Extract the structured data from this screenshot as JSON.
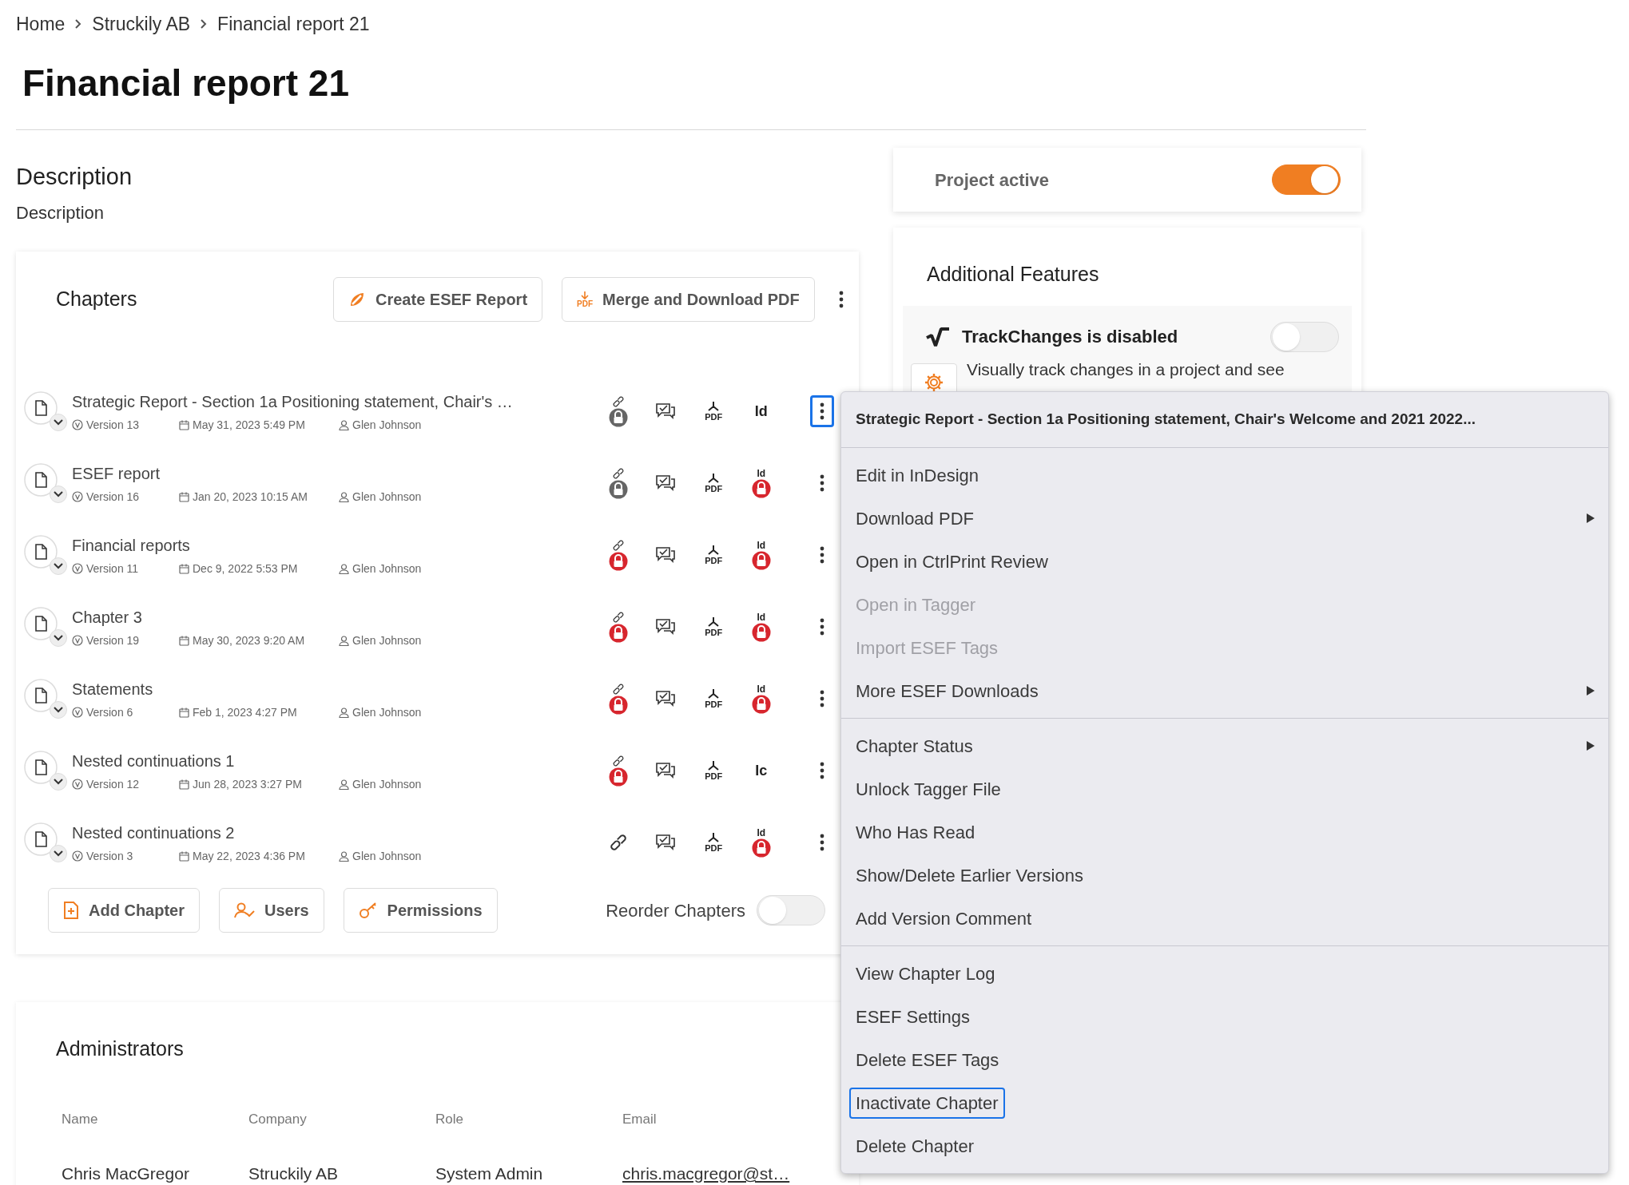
{
  "breadcrumb": [
    {
      "label": "Home"
    },
    {
      "label": "Struckily AB"
    },
    {
      "label": "Financial report 21"
    }
  ],
  "title": "Financial report 21",
  "description": {
    "heading": "Description",
    "text": "Description"
  },
  "chapters": {
    "heading": "Chapters",
    "actions": [
      {
        "label": "Create ESEF Report",
        "kind": "esef"
      },
      {
        "label": "Merge and Download PDF",
        "kind": "pdf",
        "icon_label": "PDF"
      }
    ],
    "rows": [
      {
        "title": "Strategic Report - Section 1a Positioning statement, Chair's …",
        "version": "Version 13",
        "date": "May 31, 2023 5:49 PM",
        "author": "Glen Johnson",
        "link_locked": true,
        "link_lock_alert": false,
        "pdf_label": "PDF",
        "id_label": "Id",
        "id_locked": false,
        "menu_open": true
      },
      {
        "title": "ESEF report",
        "version": "Version 16",
        "date": "Jan 20, 2023 10:15 AM",
        "author": "Glen Johnson",
        "link_locked": true,
        "link_lock_alert": false,
        "pdf_label": "PDF",
        "id_label": "Id",
        "id_locked": true,
        "menu_open": false
      },
      {
        "title": "Financial reports",
        "version": "Version 11",
        "date": "Dec 9, 2022 5:53 PM",
        "author": "Glen Johnson",
        "link_locked": true,
        "link_lock_alert": true,
        "pdf_label": "PDF",
        "id_label": "Id",
        "id_locked": true,
        "menu_open": false
      },
      {
        "title": "Chapter 3",
        "version": "Version 19",
        "date": "May 30, 2023 9:20 AM",
        "author": "Glen Johnson",
        "link_locked": true,
        "link_lock_alert": true,
        "pdf_label": "PDF",
        "id_label": "Id",
        "id_locked": true,
        "menu_open": false
      },
      {
        "title": "Statements",
        "version": "Version 6",
        "date": "Feb 1, 2023 4:27 PM",
        "author": "Glen Johnson",
        "link_locked": true,
        "link_lock_alert": true,
        "pdf_label": "PDF",
        "id_label": "Id",
        "id_locked": true,
        "menu_open": false
      },
      {
        "title": "Nested continuations 1",
        "version": "Version 12",
        "date": "Jun 28, 2023 3:27 PM",
        "author": "Glen Johnson",
        "link_locked": true,
        "link_lock_alert": true,
        "pdf_label": "PDF",
        "id_label": "Ic",
        "id_locked": false,
        "menu_open": false
      },
      {
        "title": "Nested continuations 2",
        "version": "Version 3",
        "date": "May 22, 2023 4:36 PM",
        "author": "Glen Johnson",
        "link_locked": false,
        "pdf_label": "PDF",
        "id_label": "Id",
        "id_locked": true,
        "menu_open": false
      }
    ],
    "footer_buttons": [
      {
        "label": "Add Chapter",
        "kind": "add"
      },
      {
        "label": "Users",
        "kind": "users"
      },
      {
        "label": "Permissions",
        "kind": "key"
      }
    ],
    "reorder": {
      "label": "Reorder Chapters",
      "on": false
    }
  },
  "administrators": {
    "heading": "Administrators",
    "columns": [
      "Name",
      "Company",
      "Role",
      "Email"
    ],
    "rows": [
      [
        "Chris MacGregor",
        "Struckily AB",
        "System Admin",
        "chris.macgregor@st…"
      ]
    ]
  },
  "project_active": {
    "label": "Project active",
    "on": true
  },
  "additional_features": {
    "heading": "Additional Features",
    "features": [
      {
        "label": "TrackChanges is disabled",
        "on": false,
        "description": "Visually track changes in a project and see"
      }
    ]
  },
  "context_menu": {
    "header": "Strategic Report - Section 1a Positioning statement, Chair's Welcome and 2021 2022...",
    "groups": [
      [
        {
          "label": "Edit in InDesign",
          "disabled": false,
          "submenu": false,
          "focused": false
        },
        {
          "label": "Download PDF",
          "disabled": false,
          "submenu": true,
          "focused": false
        },
        {
          "label": "Open in CtrlPrint Review",
          "disabled": false,
          "submenu": false,
          "focused": false
        },
        {
          "label": "Open in Tagger",
          "disabled": true,
          "submenu": false,
          "focused": false
        },
        {
          "label": "Import ESEF Tags",
          "disabled": true,
          "submenu": false,
          "focused": false
        },
        {
          "label": "More ESEF Downloads",
          "disabled": false,
          "submenu": true,
          "focused": false
        }
      ],
      [
        {
          "label": "Chapter Status",
          "disabled": false,
          "submenu": true,
          "focused": false
        },
        {
          "label": "Unlock Tagger File",
          "disabled": false,
          "submenu": false,
          "focused": false
        },
        {
          "label": "Who Has Read",
          "disabled": false,
          "submenu": false,
          "focused": false
        },
        {
          "label": "Show/Delete Earlier Versions",
          "disabled": false,
          "submenu": false,
          "focused": false
        },
        {
          "label": "Add Version Comment",
          "disabled": false,
          "submenu": false,
          "focused": false
        }
      ],
      [
        {
          "label": "View Chapter Log",
          "disabled": false,
          "submenu": false,
          "focused": false
        },
        {
          "label": "ESEF Settings",
          "disabled": false,
          "submenu": false,
          "focused": false
        },
        {
          "label": "Delete ESEF Tags",
          "disabled": false,
          "submenu": false,
          "focused": false
        },
        {
          "label": "Inactivate Chapter",
          "disabled": false,
          "submenu": false,
          "focused": true
        },
        {
          "label": "Delete Chapter",
          "disabled": false,
          "submenu": false,
          "focused": false
        }
      ]
    ]
  }
}
